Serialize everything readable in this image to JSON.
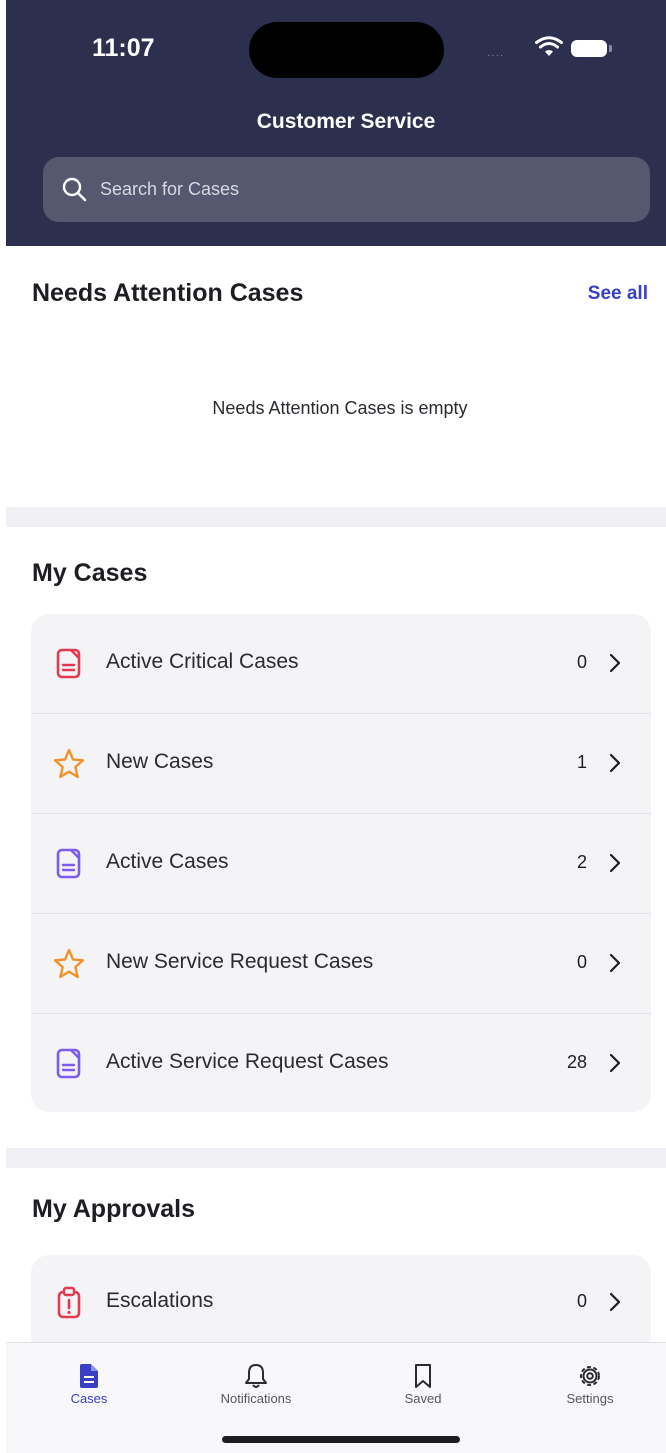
{
  "status_bar": {
    "time": "11:07",
    "signal": "····"
  },
  "header": {
    "title": "Customer Service"
  },
  "search": {
    "placeholder": "Search for Cases"
  },
  "needs_attention": {
    "title": "Needs Attention Cases",
    "see_all": "See all",
    "empty_text": "Needs Attention Cases is empty"
  },
  "my_cases": {
    "title": "My Cases",
    "items": [
      {
        "label": "Active Critical Cases",
        "count": "0",
        "icon": "document-icon",
        "color": "#e53950"
      },
      {
        "label": "New Cases",
        "count": "1",
        "icon": "star-icon",
        "color": "#f2922b"
      },
      {
        "label": "Active Cases",
        "count": "2",
        "icon": "document-icon",
        "color": "#7a5cf0"
      },
      {
        "label": "New Service Request Cases",
        "count": "0",
        "icon": "star-icon",
        "color": "#f2922b"
      },
      {
        "label": "Active Service Request Cases",
        "count": "28",
        "icon": "document-icon",
        "color": "#7a5cf0"
      }
    ]
  },
  "my_approvals": {
    "title": "My Approvals",
    "items": [
      {
        "label": "Escalations",
        "count": "0",
        "icon": "clipboard-alert-icon",
        "color": "#e53950"
      }
    ]
  },
  "tabbar": {
    "tabs": [
      {
        "label": "Cases",
        "icon": "cases-icon",
        "active": true
      },
      {
        "label": "Notifications",
        "icon": "bell-icon",
        "active": false
      },
      {
        "label": "Saved",
        "icon": "bookmark-icon",
        "active": false
      },
      {
        "label": "Settings",
        "icon": "gear-icon",
        "active": false
      }
    ]
  },
  "colors": {
    "header_bg": "#2c2f4d",
    "accent": "#3940c6"
  }
}
